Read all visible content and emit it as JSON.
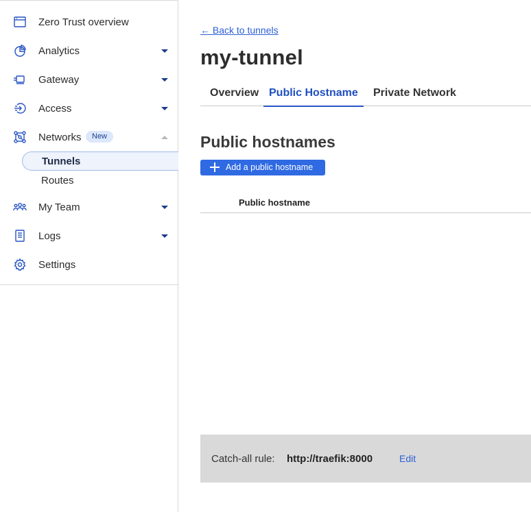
{
  "sidebar": {
    "items": [
      {
        "label": "Zero Trust overview",
        "icon": "browser-window-icon"
      },
      {
        "label": "Analytics",
        "icon": "pie-chart-icon"
      },
      {
        "label": "Gateway",
        "icon": "gateway-icon"
      },
      {
        "label": "Access",
        "icon": "access-icon"
      },
      {
        "label": "Networks",
        "icon": "network-icon",
        "badge": "New"
      },
      {
        "label": "My Team",
        "icon": "team-icon"
      },
      {
        "label": "Logs",
        "icon": "logs-icon"
      },
      {
        "label": "Settings",
        "icon": "gear-icon"
      }
    ],
    "sub_items": [
      {
        "label": "Tunnels",
        "active": true
      },
      {
        "label": "Routes",
        "active": false
      }
    ]
  },
  "main": {
    "back_link": "← Back to tunnels",
    "title": "my-tunnel",
    "tabs": [
      {
        "label": "Overview"
      },
      {
        "label": "Public Hostname",
        "active": true
      },
      {
        "label": "Private Network"
      }
    ],
    "section_title": "Public hostnames",
    "add_button": "Add a public hostname",
    "table": {
      "columns": [
        "Public hostname"
      ]
    },
    "catch_all": {
      "label": "Catch-all rule:",
      "value": "http://traefik:8000",
      "edit": "Edit"
    }
  },
  "colors": {
    "accent": "#2f6ae3",
    "link": "#2c5fd6",
    "active_tab": "#1f4fc0",
    "catch_all_bg": "#d9d9d9"
  }
}
